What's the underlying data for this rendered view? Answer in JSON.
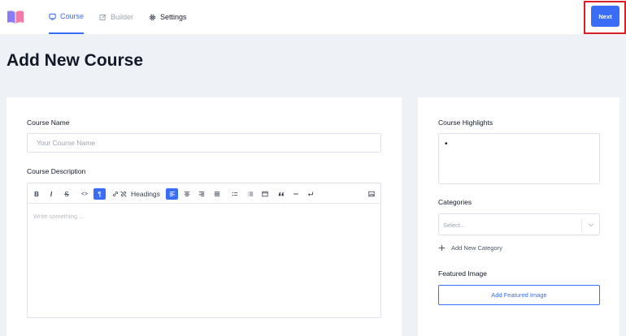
{
  "header": {
    "logo": "book-logo",
    "tabs": [
      {
        "label": "Course",
        "icon": "monitor-icon",
        "active": true
      },
      {
        "label": "Builder",
        "icon": "edit-icon",
        "active": false
      },
      {
        "label": "Settings",
        "icon": "gear-icon",
        "active": false
      }
    ],
    "next_label": "Next"
  },
  "page": {
    "title": "Add New Course"
  },
  "course_form": {
    "name_label": "Course Name",
    "name_placeholder": "Your Course Name",
    "name_value": "",
    "description_label": "Course Description",
    "toolbar": {
      "bold": "B",
      "italic": "I",
      "strike": "S",
      "code": "<>",
      "paragraph": "¶",
      "headings": "Headings"
    },
    "editor_placeholder": "Write something ..."
  },
  "sidebar": {
    "highlights_label": "Course Highlights",
    "highlights_bullet": "•",
    "categories_label": "Categories",
    "categories_placeholder": "Select...",
    "add_category_label": "Add New Category",
    "featured_image_label": "Featured Image",
    "add_featured_label": "Add Featured Image"
  },
  "colors": {
    "accent": "#3b6cf6",
    "highlight": "#d81f26",
    "background": "#eef2f7"
  }
}
